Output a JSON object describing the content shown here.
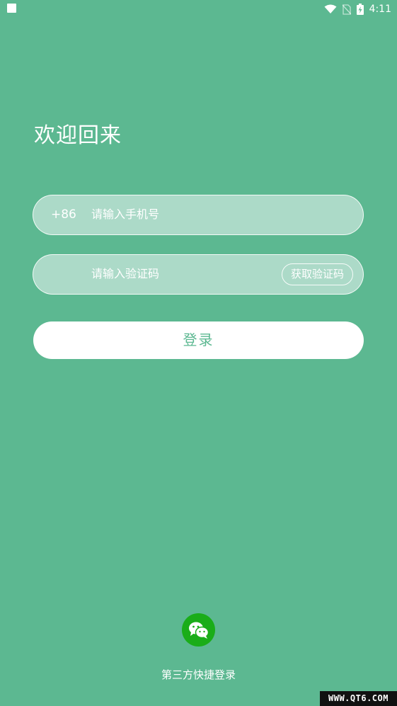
{
  "status_bar": {
    "time": "4:11",
    "icons": [
      "notification-square-icon",
      "wifi-icon",
      "no-sim-icon",
      "battery-charging-icon"
    ]
  },
  "title": "欢迎回来",
  "phone_field": {
    "prefix": "+86",
    "placeholder": "请输入手机号",
    "value": ""
  },
  "code_field": {
    "placeholder": "请输入验证码",
    "value": "",
    "get_code_label": "获取验证码"
  },
  "login_button": {
    "label": "登录"
  },
  "third_party": {
    "icon": "wechat-icon",
    "label": "第三方快捷登录"
  },
  "watermark": "WWW.QT6.COM",
  "colors": {
    "background": "#5cb891",
    "field_fill": "#acdac8",
    "wechat_green": "#1aad19",
    "button_text": "#5cb891"
  }
}
